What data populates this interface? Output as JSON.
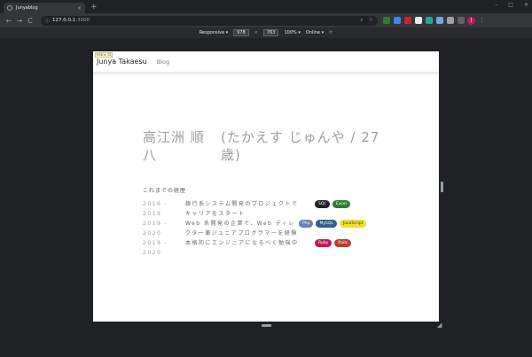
{
  "browser": {
    "tab_title": "Junyablog",
    "tab_close": "×",
    "new_tab": "+",
    "win_min": "–",
    "win_max": "□",
    "win_close": "✕",
    "back": "←",
    "forward": "→",
    "reload": "C",
    "url_host": "127.0.0.1",
    "url_port": ":3000",
    "zoom_icon": "⌕",
    "star_icon": "☆",
    "menu": "⋮",
    "avatar": "J",
    "extensions": [
      {
        "name": "green-ext-icon",
        "color": "#2e7d32"
      },
      {
        "name": "blue-ext-icon",
        "color": "#4285f4"
      },
      {
        "name": "red-ext-icon",
        "color": "#c62828"
      },
      {
        "name": "white-ext-icon",
        "color": "#e8eaed"
      },
      {
        "name": "teal-ext-icon",
        "color": "#26a69a"
      },
      {
        "name": "shield-ext-icon",
        "color": "#6fa8dc"
      },
      {
        "name": "puzzle-ext-icon",
        "color": "#9aa0a6"
      },
      {
        "name": "grey-ext-icon",
        "color": "#5f6368"
      }
    ]
  },
  "devtools": {
    "device": "Responsive ▾",
    "width": "978",
    "x": "×",
    "height": "763",
    "zoom": "100% ▾",
    "network": "Online ▾",
    "rotate": "⟳"
  },
  "page": {
    "dims_badge": "978 × 72",
    "brand": "Junya Takaesu",
    "nav_blog": "Blog",
    "hero_name_line1": "高江洲 順",
    "hero_name_line2": "八",
    "hero_reading_line1": "(たかえす じゅんや / 27",
    "hero_reading_line2": "歳)",
    "section_title": "これまでの経歴",
    "history": [
      {
        "date_line1": "2016 -",
        "date_line2": "2019",
        "desc": "銀行系システム開発のプロジェクトでキャリアをスタート",
        "tags": [
          {
            "label": "SQL",
            "color": "#212121"
          },
          {
            "label": "Excel",
            "color": "#2e7d32"
          }
        ],
        "tags_offset": 1
      },
      {
        "date_line1": "2019 -",
        "date_line2": "2020",
        "desc": "Web 系開発の企業で、Web ディレクター兼ジュニアプログラマーを経験",
        "tags": [
          {
            "label": "Php",
            "color": "#6c7eb7"
          },
          {
            "label": "MySQL",
            "color": "#2f5f8a"
          },
          {
            "label": "JavaScript",
            "color": "#f2e02a",
            "text": "#333333"
          }
        ],
        "tags_offset": 0
      },
      {
        "date_line1": "2019 -",
        "date_line2": "2020",
        "desc": "本格的にエンジニアになるべく勉強中",
        "tags": [
          {
            "label": "Ruby",
            "color": "#c2185b"
          },
          {
            "label": "Rails",
            "color": "#c0392b"
          }
        ],
        "tags_offset": 1
      }
    ]
  }
}
